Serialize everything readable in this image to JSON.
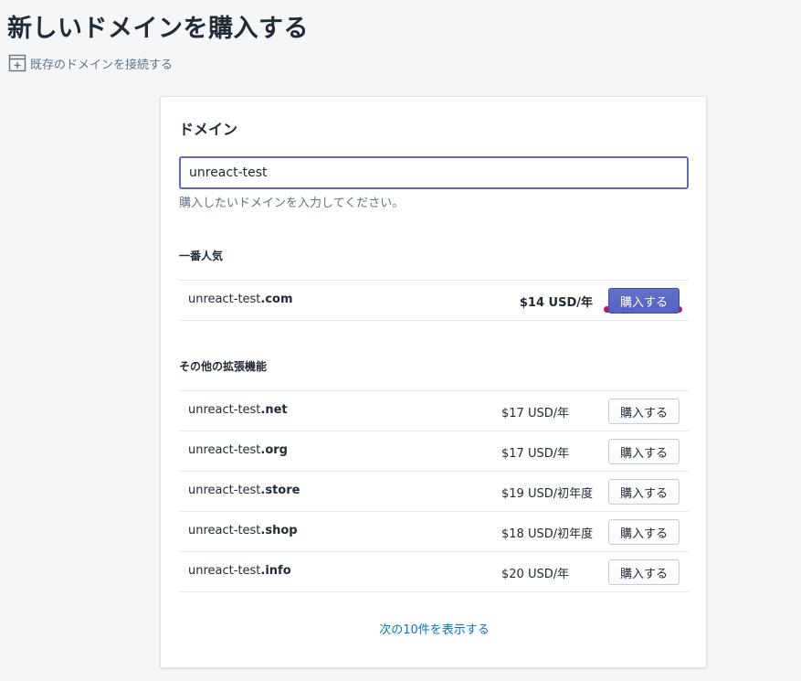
{
  "page": {
    "title": "新しいドメインを購入する",
    "connect_link": "既存のドメインを接続する",
    "connect_icon": "add-window-icon"
  },
  "card": {
    "title": "ドメイン",
    "input_value": "unreact-test",
    "input_help": "購入したいドメインを入力してください。",
    "popular": {
      "heading": "一番人気",
      "item": {
        "base": "unreact-test",
        "tld": ".com",
        "price": "$14 USD/年",
        "button": "購入する"
      }
    },
    "others": {
      "heading": "その他の拡張機能",
      "items": [
        {
          "base": "unreact-test",
          "tld": ".net",
          "price": "$17 USD/年",
          "button": "購入する"
        },
        {
          "base": "unreact-test",
          "tld": ".org",
          "price": "$17 USD/年",
          "button": "購入する"
        },
        {
          "base": "unreact-test",
          "tld": ".store",
          "price": "$19 USD/初年度",
          "button": "購入する"
        },
        {
          "base": "unreact-test",
          "tld": ".shop",
          "price": "$18 USD/初年度",
          "button": "購入する"
        },
        {
          "base": "unreact-test",
          "tld": ".info",
          "price": "$20 USD/年",
          "button": "購入する"
        }
      ]
    },
    "more_link": "次の10件を表示する"
  },
  "colors": {
    "primary": "#5c6ac4",
    "link": "#007ace",
    "annotation": "#b51a70"
  }
}
